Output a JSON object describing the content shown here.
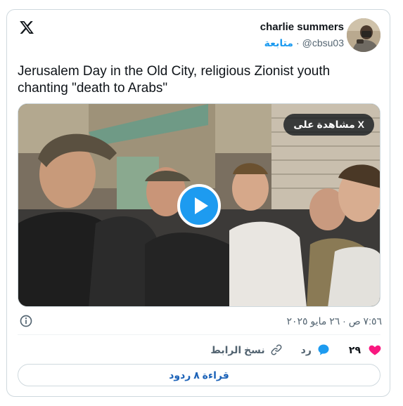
{
  "author": {
    "name": "charlie summers",
    "handle": "@cbsu03",
    "follow_label": "متابعة",
    "separator": "·"
  },
  "tweet": {
    "text": "Jerusalem Day in the Old City, religious Zionist youth chanting \"death to Arabs\""
  },
  "media": {
    "watch_on_x_label": "مشاهدة على X",
    "play_icon": "play-icon"
  },
  "meta": {
    "timestamp": "٧:٥٦ ص · ٢٦ مايو ٢٠٢٥",
    "info_icon": "info-icon"
  },
  "actions": {
    "like_count": "٢٩",
    "reply_label": "رد",
    "copy_link_label": "نسخ الرابط"
  },
  "footer": {
    "read_replies_label": "قراءة ٨ ردود"
  },
  "colors": {
    "accent": "#1d9bf0",
    "like": "#f91880",
    "muted": "#536471",
    "text": "#0f1419",
    "border": "#cfd9de"
  }
}
